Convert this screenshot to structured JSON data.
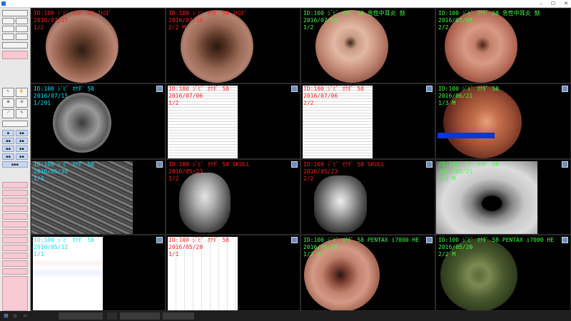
{
  "window": {
    "title": "",
    "minimize": "–",
    "maximize": "☐",
    "close": "✕"
  },
  "toolbar": {
    "labels": [
      "",
      "",
      "",
      "",
      ""
    ],
    "buttons": [
      "",
      "",
      "",
      "",
      "",
      "",
      "",
      "",
      "",
      "",
      "",
      "",
      ""
    ]
  },
  "cells": [
    {
      "lines": [
        "ID:100 ｼﾞﾋﾞ ｵｸﾀﾞ 58 ｽﾄﾛﾎﾞ",
        "2016/07/15",
        "1/2"
      ],
      "color": "red"
    },
    {
      "lines": [
        "ID:100 ｼﾞﾋﾞ ｵｸﾀﾞ 58 ｽﾄﾛﾎﾞ",
        "2016/07/15",
        "2/2 M"
      ],
      "color": "red"
    },
    {
      "lines": [
        "ID:100 ｼﾞﾋﾞ ｵｸﾀﾞ 58 急性中耳炎 鼓",
        "2016/07/08",
        "1/2"
      ],
      "color": "green"
    },
    {
      "lines": [
        "ID:100 ｼﾞﾋﾞ ｵｸﾀﾞ 58 急性中耳炎 鼓",
        "2016/07/08",
        "2/2"
      ],
      "color": "green"
    },
    {
      "lines": [
        "ID:100 ｼﾞﾋﾞ ｵｸﾀﾞ 58",
        "2016/07/15",
        "1/291"
      ],
      "color": "cyan"
    },
    {
      "lines": [
        "ID:100 ｼﾞﾋﾞ ｵｸﾀﾞ 58",
        "2016/07/06",
        "1/2"
      ],
      "color": "red"
    },
    {
      "lines": [
        "ID:100 ｼﾞﾋﾞ ｵｸﾀﾞ 58",
        "2016/07/06",
        "2/2"
      ],
      "color": "red"
    },
    {
      "lines": [
        "ID:100 ｼﾞﾋﾞ ｵｸﾀﾞ 58",
        "2016/06/21",
        "1/3 M"
      ],
      "color": "green"
    },
    {
      "lines": [
        "ID:100 ｼﾞﾋﾞ ｵｸﾀﾞ 58",
        "2016/05/30",
        "1/4"
      ],
      "color": "cyan"
    },
    {
      "lines": [
        "ID:100 ｼﾞﾋﾞ ｵｸﾀﾞ 58 SKULL",
        "2016/05/23",
        "1/2"
      ],
      "color": "red"
    },
    {
      "lines": [
        "ID:100 ｼﾞﾋﾞ ｵｸﾀﾞ 58 SKULL",
        "2016/05/23",
        "2/2"
      ],
      "color": "red"
    },
    {
      "lines": [
        "ID:100 ｼﾞﾋﾞ ｵｸﾀﾞ 58",
        "2016/05/21",
        "1/1 M"
      ],
      "color": "green"
    },
    {
      "lines": [
        "ID:100 ｼﾞﾋﾞ ｵｸﾀﾞ 58",
        "2016/05/12",
        "1/1"
      ],
      "color": "cyan"
    },
    {
      "lines": [
        "ID:100 ｼﾞﾋﾞ ｵｸﾀﾞ 58",
        "2016/05/20",
        "1/1"
      ],
      "color": "red"
    },
    {
      "lines": [
        "ID:100 ｼﾞﾋﾞ ｵｸﾀﾞ 58 PENTAX i7000 HE",
        "2016/05/20",
        "1/2 M"
      ],
      "color": "green"
    },
    {
      "lines": [
        "ID:100 ｼﾞﾋﾞ ｵｸﾀﾞ 58 PENTAX i7000 HE",
        "2016/05/20",
        "2/2 M"
      ],
      "color": "green"
    }
  ],
  "taskbar": {
    "items": [
      "",
      "",
      "",
      ""
    ],
    "time": "",
    "date": ""
  }
}
